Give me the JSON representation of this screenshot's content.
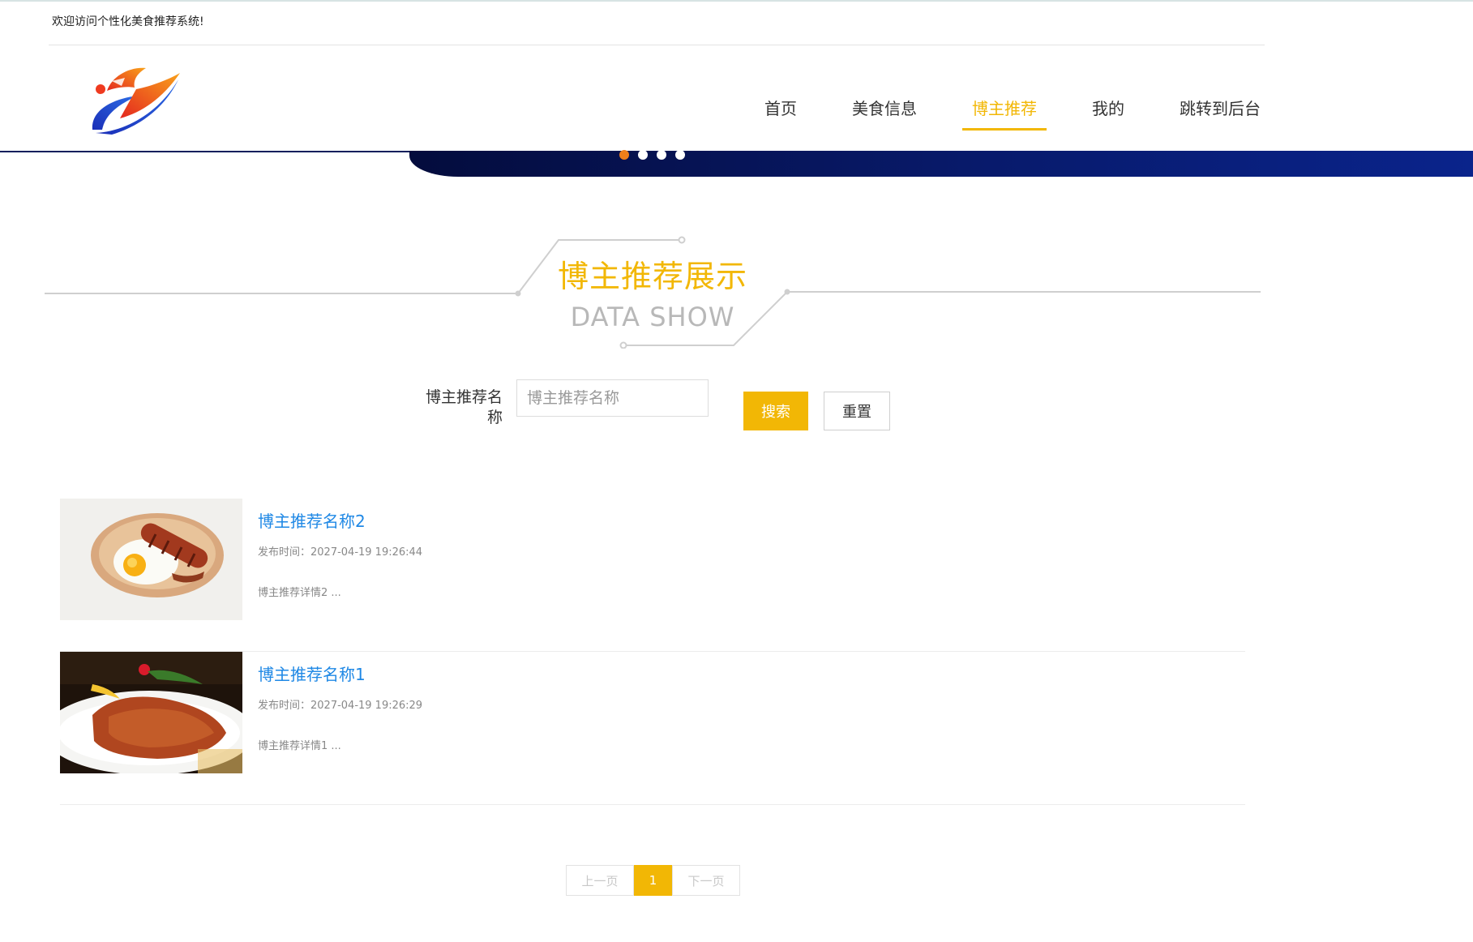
{
  "header": {
    "welcome": "欢迎访问个性化美食推荐系统!"
  },
  "nav": {
    "items": [
      {
        "label": "首页",
        "active": false
      },
      {
        "label": "美食信息",
        "active": false
      },
      {
        "label": "博主推荐",
        "active": true
      },
      {
        "label": "我的",
        "active": false
      },
      {
        "label": "跳转到后台",
        "active": false
      }
    ]
  },
  "banner": {
    "dots": 4,
    "active_dot": 0
  },
  "section": {
    "title": "博主推荐展示",
    "subtitle": "DATA SHOW"
  },
  "search": {
    "label": "博主推荐名称",
    "placeholder": "博主推荐名称",
    "value": "",
    "search_button": "搜索",
    "reset_button": "重置"
  },
  "list": [
    {
      "title": "博主推荐名称2",
      "time": "发布时间：2027-04-19 19:26:44",
      "desc": "博主推荐详情2 ..."
    },
    {
      "title": "博主推荐名称1",
      "time": "发布时间：2027-04-19 19:26:29",
      "desc": "博主推荐详情1 ..."
    }
  ],
  "pagination": {
    "prev": "上一页",
    "current": "1",
    "next": "下一页"
  },
  "colors": {
    "accent": "#f2b705",
    "link": "#1f88e5",
    "banner": "#081a6b",
    "active_dot": "#f07f1a"
  }
}
